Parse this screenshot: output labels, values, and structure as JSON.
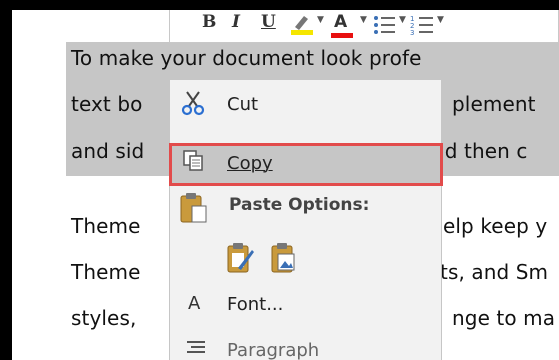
{
  "document": {
    "lines": [
      "To make your document look profe",
      "text bo",
      "plement",
      "and sid",
      "nd then c",
      "Theme",
      "elp keep y",
      "Theme",
      "ts, and Sm",
      "styles,",
      "nge to ma"
    ]
  },
  "mini_toolbar": {
    "bold": "B",
    "italic": "I",
    "underline": "U",
    "font_color": "A",
    "colors": {
      "highlight": "#f5e600",
      "font": "#e81010"
    }
  },
  "context_menu": {
    "cut": {
      "label": "Cut",
      "underline_char": "t"
    },
    "copy": {
      "label": "Copy",
      "underline_char": "C"
    },
    "paste_options": {
      "label": "Paste Options:"
    },
    "font": {
      "label": "Font...",
      "underline_char": "F"
    },
    "paragraph": {
      "label": "Paragraph"
    }
  },
  "highlight_color": "#e24b4b"
}
